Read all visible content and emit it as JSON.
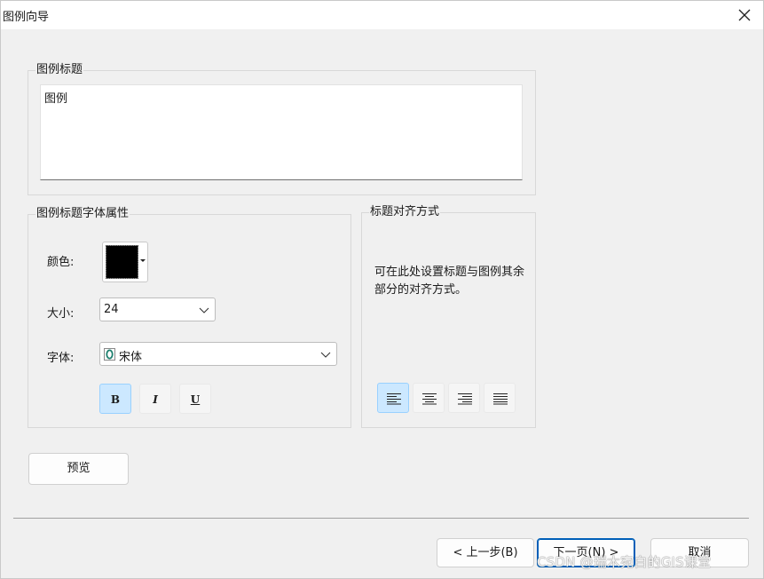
{
  "window": {
    "title": "图例向导"
  },
  "legend_title_group": {
    "label": "图例标题",
    "value": "图例"
  },
  "font_group": {
    "label": "图例标题字体属性",
    "color_label": "颜色:",
    "color_value": "#000000",
    "size_label": "大小:",
    "size_value": "24",
    "font_label": "字体:",
    "font_value": "宋体",
    "font_icon": "opentype-font-icon",
    "bold": "B",
    "italic": "I",
    "underline": "U",
    "bold_active": true
  },
  "align_group": {
    "label": "标题对齐方式",
    "description": "可在此处设置标题与图例其余部分的对齐方式。",
    "options": [
      "align-left",
      "align-center",
      "align-right",
      "align-justify"
    ],
    "selected": "align-left"
  },
  "buttons": {
    "preview": "预览",
    "back": "< 上一步(B)",
    "next": "下一页(N) >",
    "cancel": "取消"
  },
  "watermark": "CSDN @瑞木宛白的GIS课堂",
  "colors": {
    "accent": "#005fb8",
    "selected_bg": "#cce8ff",
    "selected_border": "#99d1ff"
  }
}
